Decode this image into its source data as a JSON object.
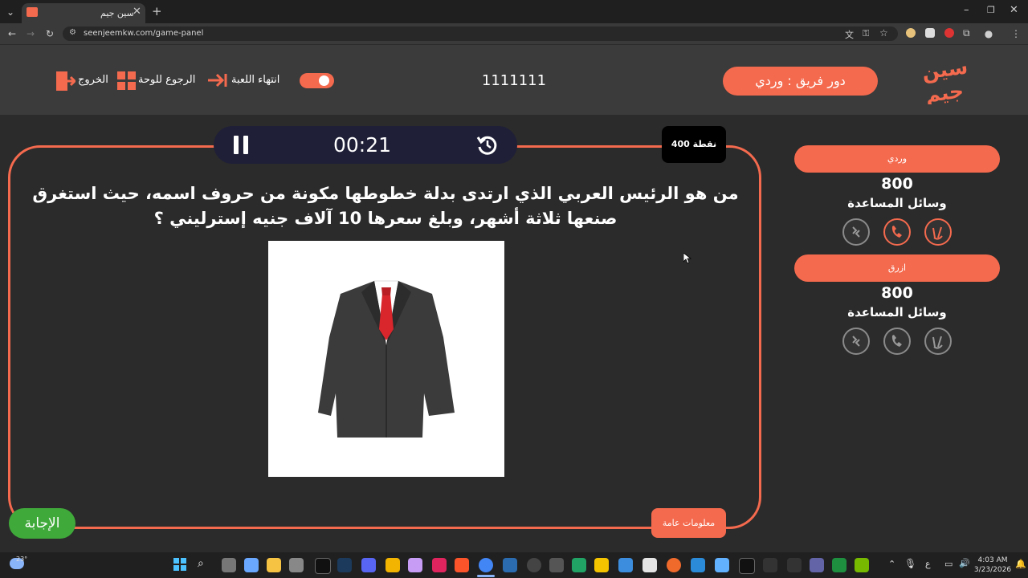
{
  "browser": {
    "tab_title": "سين جيم",
    "url": "seenjeemkw.com/game-panel",
    "new_tab": "+"
  },
  "header": {
    "logo_text": "سين جيم",
    "turn_label": "دور فريق : وردي",
    "game_code": "1111111",
    "end_game_label": "انتهاء اللعبة",
    "back_to_board_label": "الرجوع للوحة",
    "exit_label": "الخروج"
  },
  "question": {
    "points_label": "400 نقطة",
    "timer": "00:21",
    "text": "من هو الرئيس العربي الذي ارتدى بدلة خطوطها مكونة من حروف اسمه، حيث استغرق صنعها ثلاثة أشهر، وبلغ سعرها 10 آلاف جنيه إسترليني ؟",
    "answer_button": "الإجابة",
    "category_label": "معلومات عامة"
  },
  "teams": [
    {
      "name": "وردي",
      "score": "800",
      "aids_label": "وسائل المساعدة",
      "aids": [
        "two-answers-icon",
        "call-friend-icon",
        "rest-icon"
      ],
      "aids_active": [
        true,
        true,
        false
      ]
    },
    {
      "name": "ازرق",
      "score": "800",
      "aids_label": "وسائل المساعدة",
      "aids": [
        "two-answers-icon",
        "call-friend-icon",
        "rest-icon"
      ],
      "aids_active": [
        false,
        false,
        false
      ]
    }
  ],
  "taskbar": {
    "weather": "23°",
    "time": "4:03 AM",
    "date": "3/23/2026",
    "lang": "ع"
  },
  "colors": {
    "accent": "#f46a4e",
    "green": "#3faa3a",
    "timer_bg": "#1f1f38",
    "background": "#2b2b2b",
    "header_bg": "#3b3b3b"
  }
}
